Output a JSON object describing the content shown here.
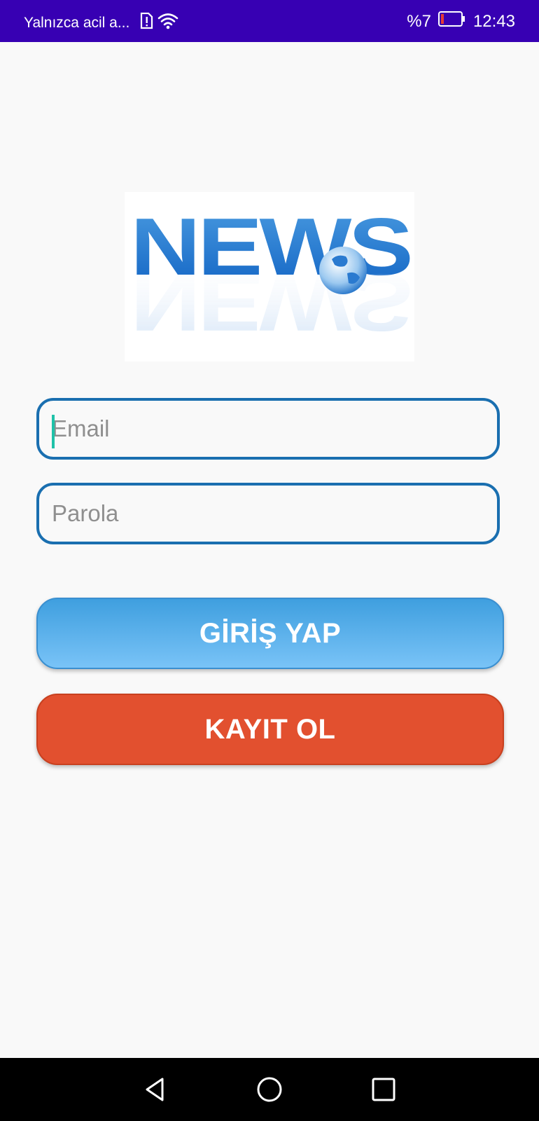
{
  "status_bar": {
    "carrier_text": "Yalnızca acil a...",
    "battery_text": "%7",
    "time": "12:43",
    "background_color": "#3700b3",
    "icons": [
      "sim-alert-icon",
      "wifi-icon",
      "battery-low-icon"
    ]
  },
  "logo": {
    "text": "NEWS"
  },
  "login_form": {
    "email_placeholder": "Email",
    "email_value": "",
    "password_placeholder": "Parola",
    "password_value": ""
  },
  "buttons": {
    "login_label": "GİRİŞ YAP",
    "register_label": "KAYIT OL",
    "login_color": "#5aaeed",
    "register_color": "#e2502f"
  },
  "nav_bar": {
    "icons": [
      "back-icon",
      "home-icon",
      "recent-apps-icon"
    ]
  }
}
